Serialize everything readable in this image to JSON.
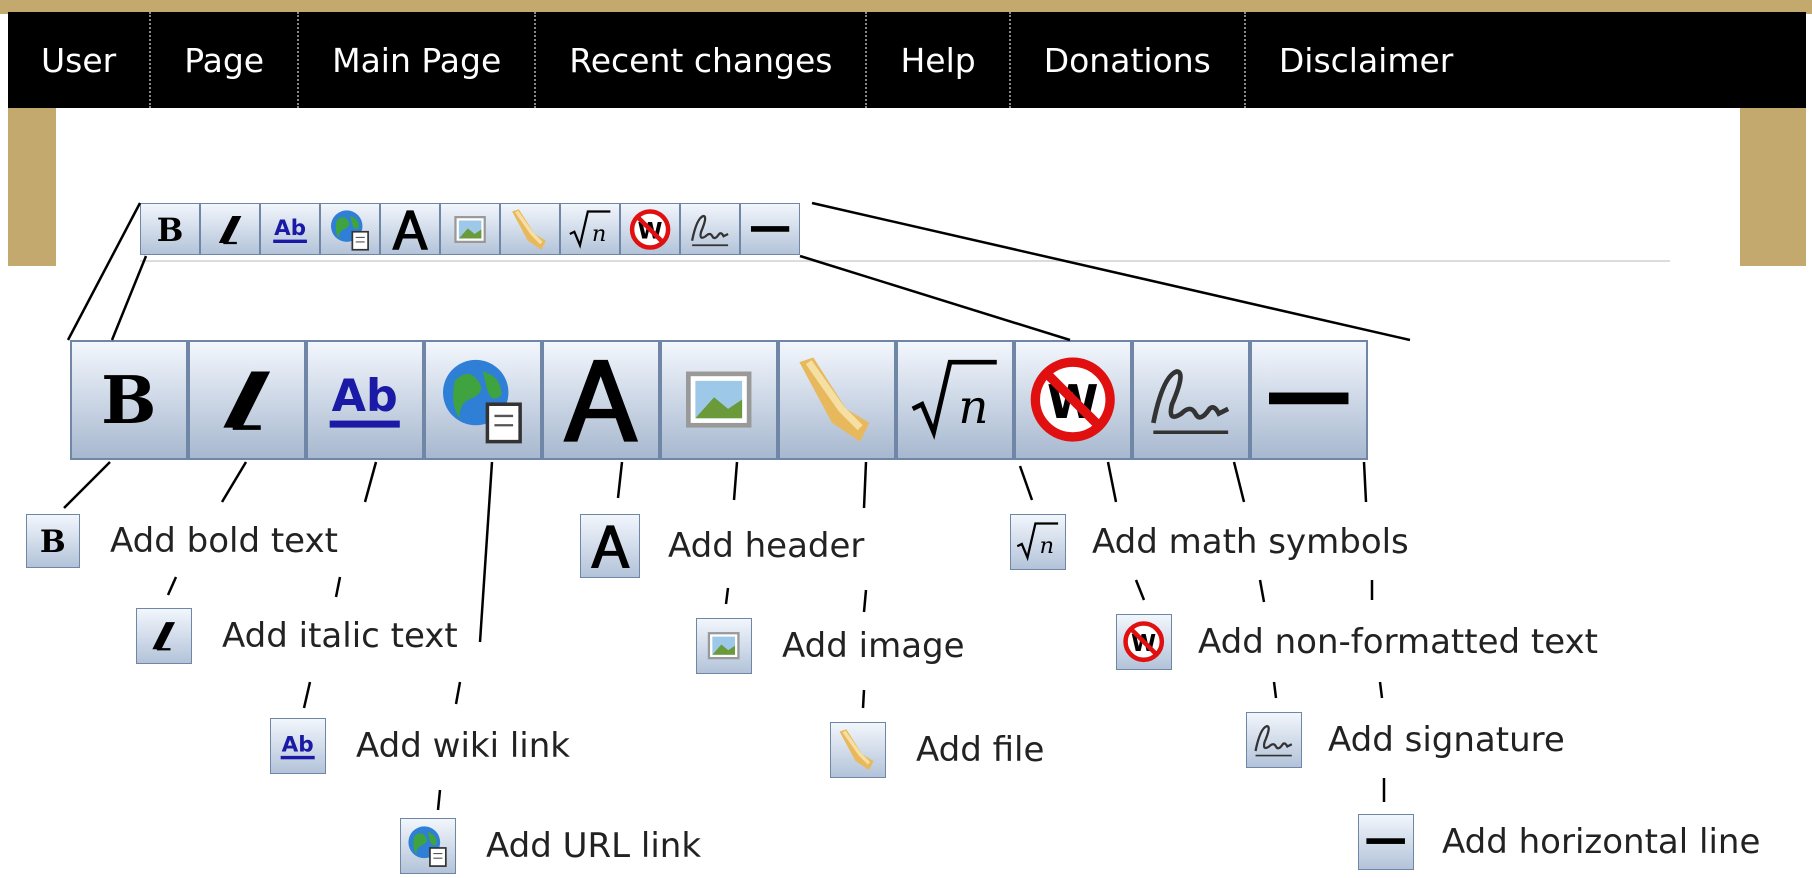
{
  "nav": {
    "items": [
      "User",
      "Page",
      "Main Page",
      "Recent changes",
      "Help",
      "Donations",
      "Disclaimer"
    ]
  },
  "toolbar": {
    "buttons": [
      {
        "icon": "bold-icon"
      },
      {
        "icon": "italic-icon"
      },
      {
        "icon": "wiki-link-icon"
      },
      {
        "icon": "url-link-icon"
      },
      {
        "icon": "header-icon"
      },
      {
        "icon": "image-icon"
      },
      {
        "icon": "file-icon"
      },
      {
        "icon": "math-icon"
      },
      {
        "icon": "nowiki-icon"
      },
      {
        "icon": "signature-icon"
      },
      {
        "icon": "horizontal-line-icon"
      }
    ]
  },
  "legend": {
    "bold": "Add bold text",
    "italic": "Add italic text",
    "wiki_link": "Add wiki link",
    "url_link": "Add URL link",
    "header": "Add header",
    "image": "Add image",
    "file": "Add file",
    "math": "Add math symbols",
    "nowiki": "Add non-formatted text",
    "signature": "Add signature",
    "hr": "Add horizontal line"
  },
  "colors": {
    "frame": "#c4a96e",
    "navbar": "#000000",
    "button_border": "#6f86a6",
    "link_blue": "#1a1aa6",
    "nowiki_red": "#e01010"
  }
}
